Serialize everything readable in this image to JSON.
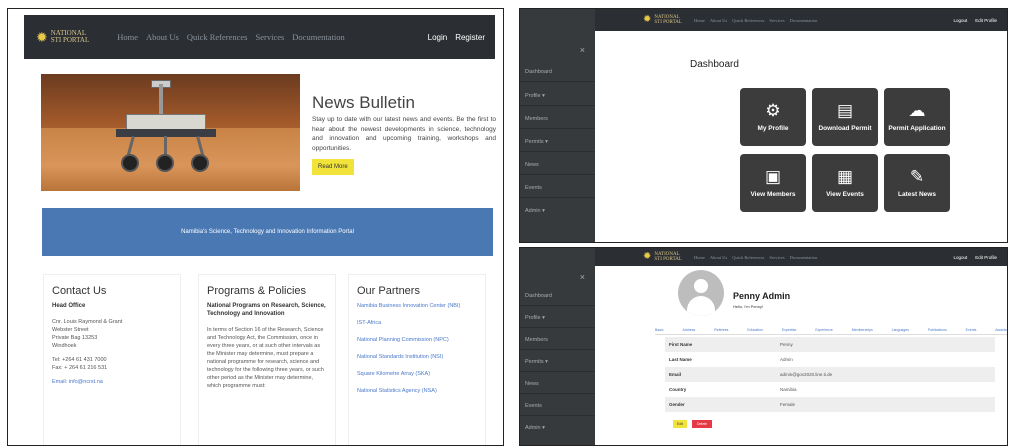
{
  "site": {
    "logo_line1": "NATIONAL",
    "logo_line2": "STI PORTAL",
    "nav": [
      "Home",
      "About Us",
      "Quick References",
      "Services",
      "Documentation"
    ],
    "login": "Login",
    "register": "Register",
    "logout": "Logout",
    "edit_profile": "Edit Profile"
  },
  "home": {
    "news_title": "News Bulletin",
    "news_text": "Stay up to date with our latest news and events. Be the first to hear about the newest developments in science, technology and innovation and upcoming training, workshops and opportunities.",
    "read_more": "Read More",
    "banner": "Namibia's Science, Technology and Innovation Information Portal",
    "contact": {
      "title": "Contact Us",
      "sub": "Head Office",
      "address": [
        "Cnr. Louis Raymond & Grant",
        "Webster Street",
        "Private Bag 13253",
        "Windhoek"
      ],
      "tel": "Tel: +264 61 431 7000",
      "fax": "Fax: + 264 61 216 531",
      "email": "Email: info@ncrst.na"
    },
    "programs": {
      "title": "Programs & Policies",
      "sub": "National Programs on Research, Science, Technology and Innovation",
      "text": "In terms of Section 16 of the Research, Science and Technology Act, the Commission, once in every three years, or at such other intervals as the Minister may determine, must prepare a national programme for research, science and technology for the following three years, or such other period as the Minister may determine, which programme must:"
    },
    "partners": {
      "title": "Our Partners",
      "links": [
        "Namibia Business Innovation Center (NBI)",
        "IST-Africa",
        "National Planning Commission (NPC)",
        "National Standards Institution (NSI)",
        "Square Kilometre Array (SKA)",
        "National Statistics Agency (NSA)"
      ]
    }
  },
  "sidebar": {
    "close": "×",
    "items": [
      "Dashboard",
      "Profile ▾",
      "Members",
      "Permits ▾",
      "News",
      "Events",
      "Admin ▾"
    ]
  },
  "dashboard": {
    "title": "Dashboard",
    "tiles": [
      {
        "label": "My Profile",
        "icon": "user-gear-icon"
      },
      {
        "label": "Download Permit",
        "icon": "document-icon"
      },
      {
        "label": "Permit Application",
        "icon": "cloud-upload-icon"
      },
      {
        "label": "View Members",
        "icon": "id-card-icon"
      },
      {
        "label": "View Events",
        "icon": "calendar-icon"
      },
      {
        "label": "Latest News",
        "icon": "news-edit-icon"
      }
    ]
  },
  "profile": {
    "name": "Penny Admin",
    "hello": "Hello, I'm Penny!",
    "tabs": [
      "Basic",
      "Address",
      "Referees",
      "Education",
      "Expertise",
      "Experience",
      "Memberships",
      "Languages",
      "Publications",
      "Events",
      "Awards"
    ],
    "rows": [
      {
        "key": "First Name",
        "value": "Penny"
      },
      {
        "key": "Last Name",
        "value": "Admin"
      },
      {
        "key": "Email",
        "value": "admin@gov2020.line.ti.de"
      },
      {
        "key": "Country",
        "value": "Namibia"
      },
      {
        "key": "Gender",
        "value": "Female"
      }
    ],
    "edit": "Edit",
    "delete": "Delete"
  }
}
